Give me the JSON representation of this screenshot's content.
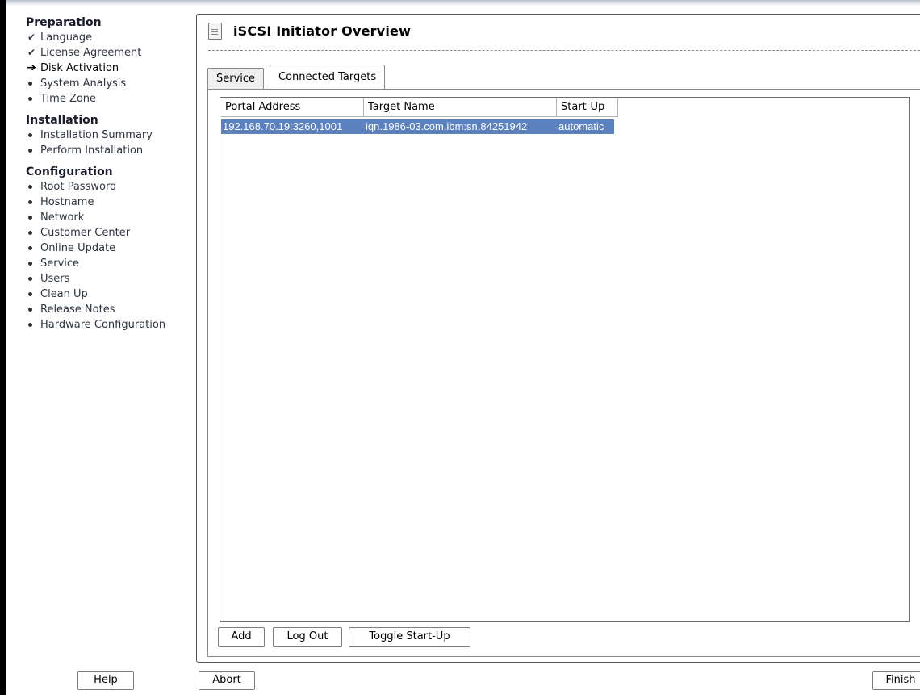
{
  "sidebar": {
    "sections": [
      {
        "title": "Preparation",
        "items": [
          {
            "label": "Language",
            "status": "done"
          },
          {
            "label": "License Agreement",
            "status": "done"
          },
          {
            "label": "Disk Activation",
            "status": "current"
          },
          {
            "label": "System Analysis",
            "status": "pending"
          },
          {
            "label": "Time Zone",
            "status": "pending"
          }
        ]
      },
      {
        "title": "Installation",
        "items": [
          {
            "label": "Installation Summary",
            "status": "pending"
          },
          {
            "label": "Perform Installation",
            "status": "pending"
          }
        ]
      },
      {
        "title": "Configuration",
        "items": [
          {
            "label": "Root Password",
            "status": "pending"
          },
          {
            "label": "Hostname",
            "status": "pending"
          },
          {
            "label": "Network",
            "status": "pending"
          },
          {
            "label": "Customer Center",
            "status": "pending"
          },
          {
            "label": "Online Update",
            "status": "pending"
          },
          {
            "label": "Service",
            "status": "pending"
          },
          {
            "label": "Users",
            "status": "pending"
          },
          {
            "label": "Clean Up",
            "status": "pending"
          },
          {
            "label": "Release Notes",
            "status": "pending"
          },
          {
            "label": "Hardware Configuration",
            "status": "pending"
          }
        ]
      }
    ]
  },
  "main": {
    "title": "iSCSI Initiator Overview",
    "tabs": [
      {
        "label": "Service",
        "active": false
      },
      {
        "label": "Connected Targets",
        "active": true
      }
    ],
    "table": {
      "columns": [
        "Portal Address",
        "Target Name",
        "Start-Up"
      ],
      "rows": [
        {
          "portal": "192.168.70.19:3260,1001",
          "target": "iqn.1986-03.com.ibm:sn.84251942",
          "startup": "automatic",
          "selected": true
        }
      ]
    },
    "buttons": {
      "add": "Add",
      "logout": "Log Out",
      "toggle": "Toggle Start-Up"
    }
  },
  "footer": {
    "help": "Help",
    "abort": "Abort",
    "finish": "Finish"
  },
  "colors": {
    "selection": "#5b81bf",
    "left_bar": "#000000"
  }
}
